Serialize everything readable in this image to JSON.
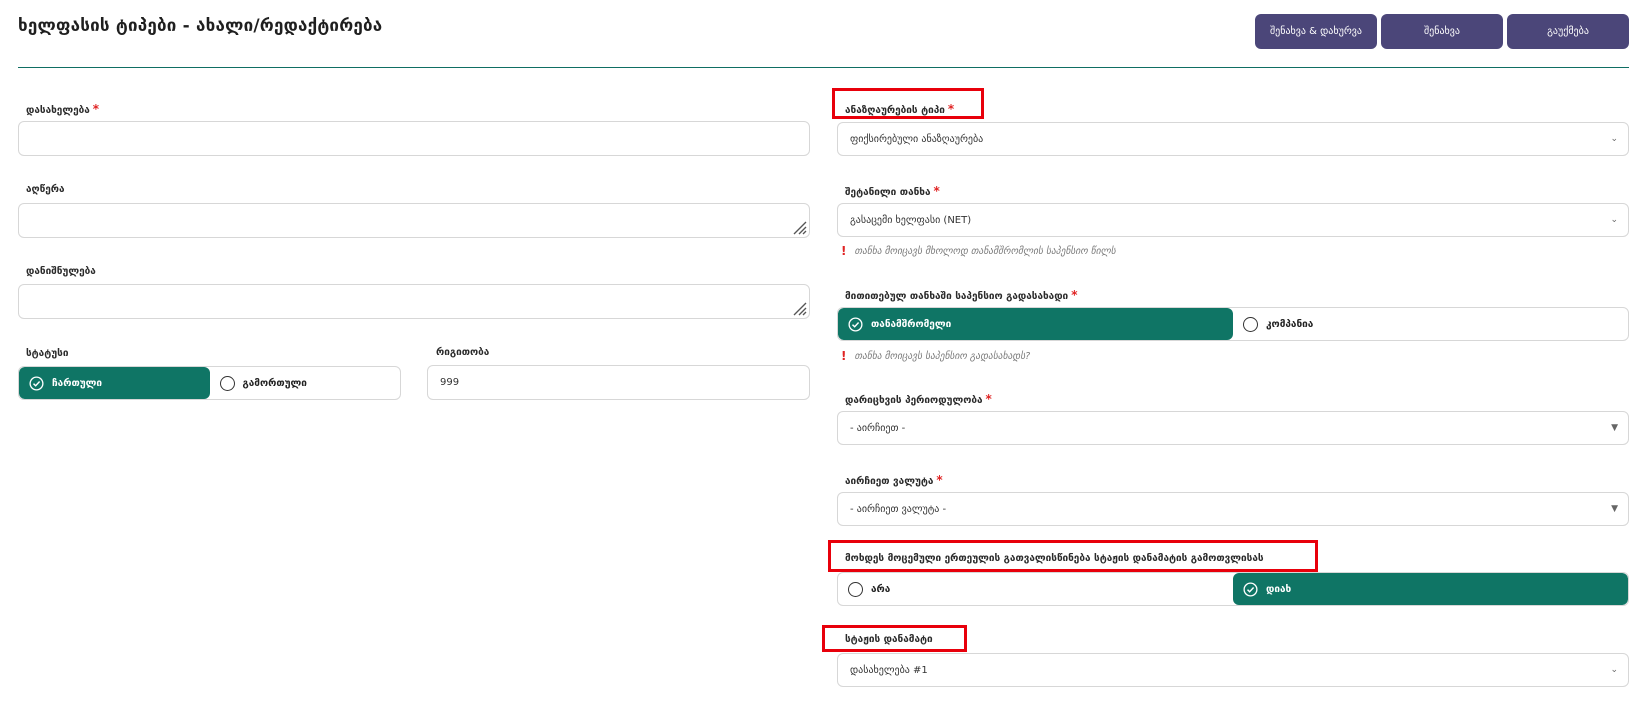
{
  "page": {
    "title": "ხელფასის ტიპები - ახალი/რედაქტირება"
  },
  "toolbar": {
    "save_close_label": "შენახვა & დახურვა",
    "save_label": "შენახვა",
    "cancel_label": "გაუქმება"
  },
  "left": {
    "name_label": "დასახელება",
    "description_label": "აღწერა",
    "purpose_label": "დანიშნულება",
    "status_label": "სტატუსი",
    "status_on": "ჩართული",
    "status_off": "გამორთული",
    "order_label": "რიგითობა",
    "order_value": "999"
  },
  "right": {
    "accrual_type_label": "ანაზღაურების ტიპი",
    "accrual_type_value": "ფიქსირებული ანაზღაურება",
    "input_amount_label": "შეტანილი თანხა",
    "input_amount_value": "გასაცემი ხელფასი (NET)",
    "input_amount_hint": "თანხა მოიცავს მხოლოდ თანამშრომლის საპენსიო წილს",
    "pension_payer_label": "მითითებულ თანხაში საპენსიო გადასახადი",
    "pension_employee": "თანამშრომელი",
    "pension_company": "კომპანია",
    "pension_hint": "თანხა მოიცავს საპენსიო გადასახადს?",
    "periodicity_label": "დარიცხვის პერიოდულობა",
    "periodicity_value": "- აირჩიეთ -",
    "currency_label": "აირჩიეთ ვალუტა",
    "currency_value": "- აირჩიეთ ვალუტა -",
    "consider_rate_label": "მოხდეს მოცემული ერთეულის გათვალისწინება სტაჟის დანამატის გამოთვლისას",
    "consider_no": "არა",
    "consider_yes": "დიახ",
    "seniority_label": "სტაჟის დანამატი",
    "seniority_value": "დასახელება #1"
  },
  "colors": {
    "accent_green": "#0f7565",
    "button_purple": "#4b4679",
    "required_red": "#e02424",
    "highlight_red": "#e8000b"
  }
}
